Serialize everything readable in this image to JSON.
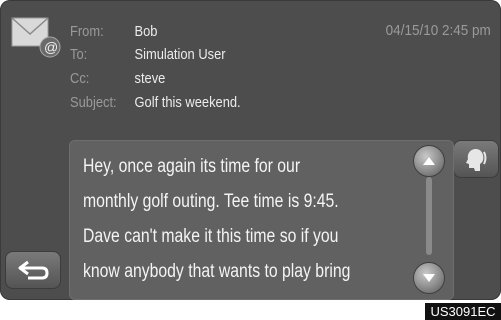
{
  "message": {
    "from_label": "From:",
    "from": "Bob",
    "to_label": "To:",
    "to": "Simulation User",
    "cc_label": "Cc:",
    "cc": "steve",
    "subject_label": "Subject:",
    "subject": "Golf this weekend.",
    "datetime": "04/15/10 2:45 pm",
    "body_lines": [
      "Hey, once again its time for our",
      "monthly golf outing. Tee time is 9:45.",
      "Dave can't make it this time so if you",
      "know anybody that wants to play bring"
    ]
  },
  "icons": {
    "mail": "mail-icon",
    "scroll_up": "chevron-up-icon",
    "scroll_down": "chevron-down-icon",
    "read_aloud": "speaker-head-icon",
    "back": "back-arrow-icon"
  },
  "colors": {
    "screen_bg": "#4d4d4d",
    "body_bg": "#616161",
    "label": "#9a9a9a",
    "value": "#ececec"
  },
  "footer": {
    "model_code": "US3091EC"
  }
}
